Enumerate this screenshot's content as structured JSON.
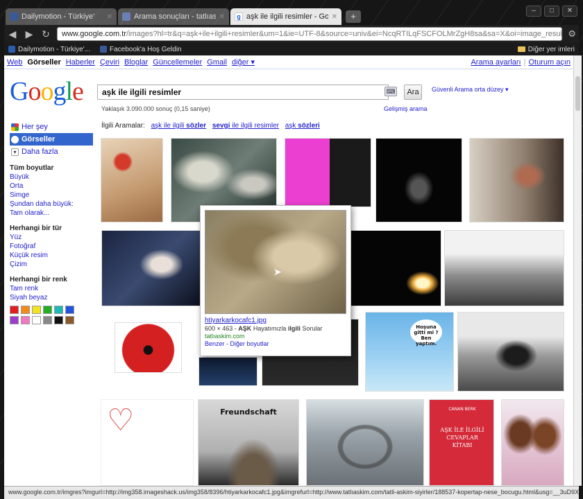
{
  "tabs": [
    {
      "title": "Dailymotion - Türkiye'",
      "favicon": "facebook-favicon",
      "color": "#3b5998"
    },
    {
      "title": "Arama sonuçları - tatlıaskim",
      "favicon": "page-favicon",
      "color": "#6a7fb5"
    },
    {
      "title": "aşk ile ilgili resimler - Google Görseller",
      "favicon": "google-favicon",
      "color": "#ffffff",
      "active": true
    }
  ],
  "omnibox": {
    "domain": "www.google.com.tr",
    "path": "/images?hl=tr&q=aşk+ile+ilgili+resimler&um=1&ie=UTF-8&source=univ&ei=NcqRTILqFSCFOLMrZgH8sa&sa=X&oi=image_result"
  },
  "bookmarks": [
    {
      "label": "Dailymotion - Türkiye'...",
      "color": "#2a5db0"
    },
    {
      "label": "Facebook'a Hoş Geldin",
      "color": "#3b5998"
    }
  ],
  "other_bookmarks": "Diğer yer imleri",
  "gbar": {
    "links": [
      "Web",
      "Görseller",
      "Haberler",
      "Çeviri",
      "Bloglar",
      "Güncellemeler",
      "Gmail",
      "diğer ▾"
    ],
    "active": "Görseller",
    "settings": "Arama ayarları",
    "signin": "Oturum açın"
  },
  "logo": {
    "letters": [
      "G",
      "o",
      "o",
      "g",
      "l",
      "e"
    ],
    "colors": [
      "#1a5fd8",
      "#d62d20",
      "#f4b400",
      "#1a5fd8",
      "#0f9d58",
      "#d62d20"
    ]
  },
  "search": {
    "query": "aşk ile ilgili resimler",
    "button": "Ara",
    "safesearch": "Güvenli Arama orta düzey ▾",
    "results_count": "Yaklaşık 3.090.000 sonuç (0,15 saniye)",
    "advanced": "Gelişmiş arama"
  },
  "leftnav": {
    "types": [
      {
        "label": "Her şey",
        "icon": "everything-icon"
      },
      {
        "label": "Görseller",
        "icon": "images-icon",
        "active": true
      },
      {
        "label": "Daha fazla",
        "icon": "more-icon"
      }
    ],
    "size_header": "Tüm boyutlar",
    "sizes": [
      "Büyük",
      "Orta",
      "Simge",
      "Şundan daha büyük:",
      "Tam olarak..."
    ],
    "type_header": "Herhangi bir tür",
    "types_list": [
      "Yüz",
      "Fotoğraf",
      "Küçük resim",
      "Çizim"
    ],
    "color_header": "Herhangi bir renk",
    "colors_list": [
      "Tam renk",
      "Siyah beyaz"
    ],
    "swatches": [
      "#e02020",
      "#f28a1c",
      "#f2e320",
      "#22b022",
      "#1fb8b8",
      "#2255dd",
      "#9b3fc9",
      "#f07ac0",
      "#ffffff",
      "#888888",
      "#111111",
      "#8a5a2a"
    ]
  },
  "related": {
    "label": "İlgili Aramalar:",
    "items": [
      {
        "pre": "aşk ile ilgili ",
        "bold": "sözler"
      },
      {
        "pre": "",
        "bold": "sevgi",
        "post": " ile ilgili resimler"
      },
      {
        "pre": "aşk ",
        "bold": "sözleri"
      }
    ]
  },
  "preview": {
    "filename": "htiyarkarkocafc1.jpg",
    "meta_pre": "600 × 463 - ",
    "meta_bold1": "AŞK",
    "meta_mid": " Hayatımızla ",
    "meta_bold2": "ilgili",
    "meta_post": " Sorular",
    "source": "tatlıaskim.com",
    "more": "Benzer - Diğer boyutlar"
  },
  "thumb_texts": {
    "freundschaft": "Freundschaft",
    "cartoon": "Hoşuna gitti mi ? Ben yaptım.",
    "book_author": "CANAN BERK",
    "book_title": "AŞK İLE İLGİLİ CEVAPLAR KİTABI"
  },
  "statusbar": "www.google.com.tr/imgres?imgurl=http://img358.imageshack.us/img358/8396/htiyarkarkocafc1.jpg&imgrefurl=http://www.tatlıaskim.com/tatli-askim-siyirler/188537-kopertap-nese_bocugu.html&usg=__3uD9XNF..."
}
